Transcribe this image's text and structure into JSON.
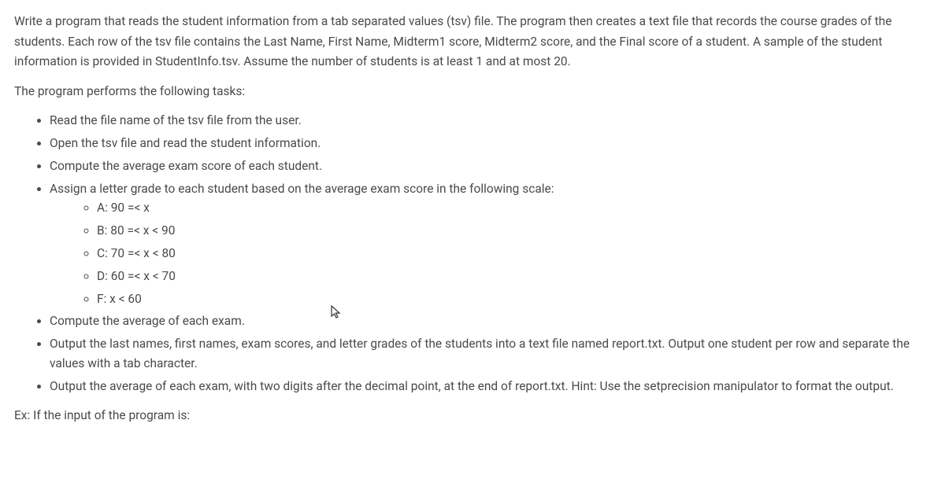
{
  "intro_paragraph": "Write a program that reads the student information from a tab separated values (tsv) file. The program then creates a text file that records the course grades of the students. Each row of the tsv file contains the Last Name, First Name, Midterm1 score, Midterm2 score, and the Final score of a student. A sample of the student information is provided in StudentInfo.tsv. Assume the number of students is at least 1 and at most 20.",
  "tasks_heading": "The program performs the following tasks:",
  "tasks": {
    "item1": "Read the file name of the tsv file from the user.",
    "item2": "Open the tsv file and read the student information.",
    "item3": "Compute the average exam score of each student.",
    "item4": "Assign a letter grade to each student based on the average exam score in the following scale:",
    "grades": {
      "a": "A: 90 =< x",
      "b": "B: 80 =< x < 90",
      "c": "C: 70 =< x < 80",
      "d": "D: 60 =< x < 70",
      "f": "F: x < 60"
    },
    "item5": "Compute the average of each exam.",
    "item6": "Output the last names, first names, exam scores, and letter grades of the students into a text file named report.txt. Output one student per row and separate the values with a tab character.",
    "item7": "Output the average of each exam, with two digits after the decimal point, at the end of report.txt. Hint: Use the setprecision manipulator to format the output."
  },
  "example_heading": "Ex: If the input of the program is:"
}
